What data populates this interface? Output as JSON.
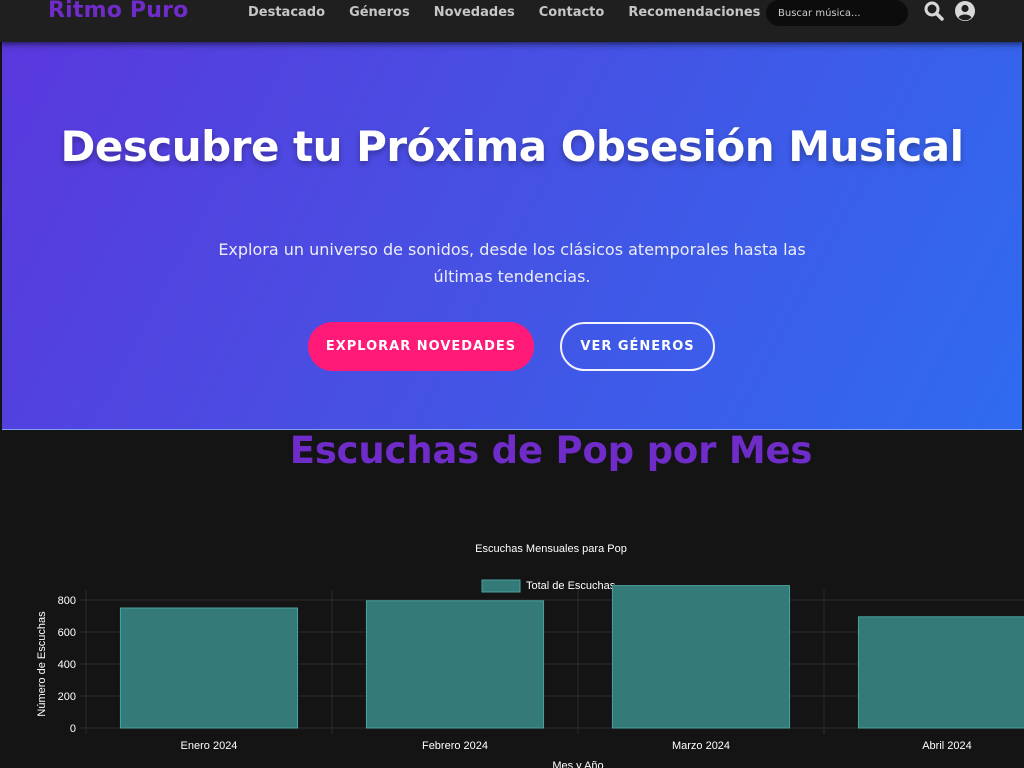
{
  "nav": {
    "brand": "Ritmo Puro",
    "links": [
      "Destacado",
      "Géneros",
      "Novedades",
      "Contacto",
      "Recomendaciones"
    ],
    "search_placeholder": "Buscar música...",
    "icons": [
      "search-icon",
      "user-circle-icon"
    ]
  },
  "hero": {
    "title": "Descubre tu Próxima Obsesión Musical",
    "subtitle": "Explora un universo de sonidos, desde los clásicos atemporales hasta las últimas tendencias.",
    "primary_button": "EXPLORAR NOVEDADES",
    "secondary_button": "VER GÉNEROS"
  },
  "section": {
    "title": "Escuchas de Pop por Mes"
  },
  "colors": {
    "brand": "#6f2cc9",
    "primary_button": "#ff1a77",
    "bar_fill": "#347a78",
    "bar_border": "#4aa39f"
  },
  "chart_data": {
    "type": "bar",
    "title": "Escuchas Mensuales para Pop",
    "legend_position": "top",
    "categories": [
      "Enero 2024",
      "Febrero 2024",
      "Marzo 2024",
      "Abril 2024"
    ],
    "series": [
      {
        "name": "Total de Escuchas",
        "values": [
          750,
          795,
          890,
          695
        ]
      }
    ],
    "xlabel": "Mes y Año",
    "ylabel": "Número de Escuchas",
    "ylim": [
      0,
      800
    ],
    "yticks": [
      0,
      200,
      400,
      600,
      800
    ],
    "grid": true
  }
}
